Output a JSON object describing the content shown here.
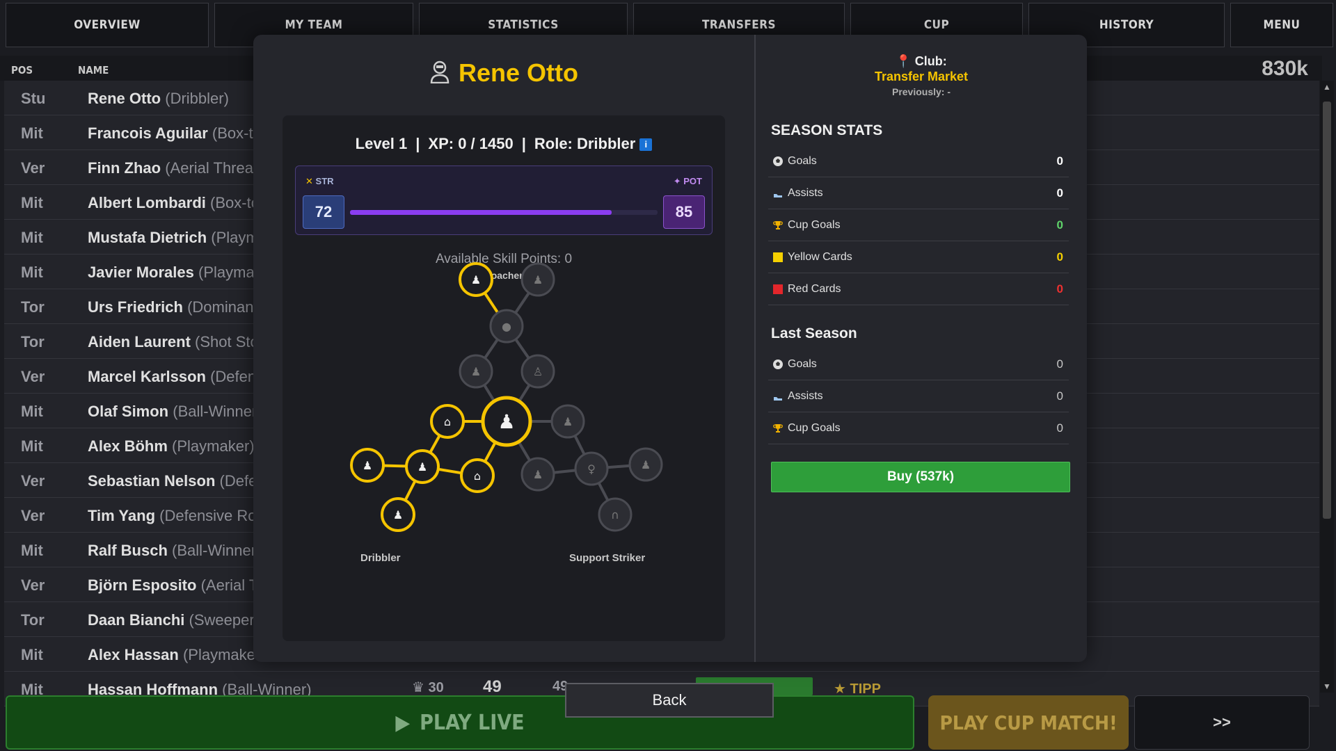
{
  "nav": {
    "tabs": [
      {
        "label": "OVERVIEW"
      },
      {
        "label": "MY TEAM"
      },
      {
        "label": "STATISTICS"
      },
      {
        "label": "TRANSFERS"
      },
      {
        "label": "CUP"
      },
      {
        "label": "HISTORY"
      },
      {
        "label": "MENU"
      }
    ]
  },
  "table": {
    "headers": {
      "pos": "POS",
      "name": "NAME"
    },
    "balance": "830k",
    "rows": [
      {
        "pos": "Stu",
        "name": "Rene Otto",
        "role": "(Dribbler)"
      },
      {
        "pos": "Mit",
        "name": "Francois Aguilar",
        "role": "(Box-to"
      },
      {
        "pos": "Ver",
        "name": "Finn Zhao",
        "role": "(Aerial Threat"
      },
      {
        "pos": "Mit",
        "name": "Albert Lombardi",
        "role": "(Box-to"
      },
      {
        "pos": "Mit",
        "name": "Mustafa Dietrich",
        "role": "(Playm"
      },
      {
        "pos": "Mit",
        "name": "Javier Morales",
        "role": "(Playmal"
      },
      {
        "pos": "Tor",
        "name": "Urs Friedrich",
        "role": "(Dominant"
      },
      {
        "pos": "Tor",
        "name": "Aiden Laurent",
        "role": "(Shot Sto"
      },
      {
        "pos": "Ver",
        "name": "Marcel Karlsson",
        "role": "(Defens"
      },
      {
        "pos": "Mit",
        "name": "Olaf Simon",
        "role": "(Ball-Winner"
      },
      {
        "pos": "Mit",
        "name": "Alex Böhm",
        "role": "(Playmaker)"
      },
      {
        "pos": "Ver",
        "name": "Sebastian Nelson",
        "role": "(Defe"
      },
      {
        "pos": "Ver",
        "name": "Tim Yang",
        "role": "(Defensive Ro"
      },
      {
        "pos": "Mit",
        "name": "Ralf Busch",
        "role": "(Ball-Winner"
      },
      {
        "pos": "Ver",
        "name": "Björn Esposito",
        "role": "(Aerial Tl"
      },
      {
        "pos": "Tor",
        "name": "Daan Bianchi",
        "role": "(Sweeper"
      },
      {
        "pos": "Mit",
        "name": "Alex Hassan",
        "role": "(Playmaker"
      },
      {
        "pos": "Mit",
        "name": "Hassan Hoffmann",
        "role": "(Ball-Winner)"
      }
    ],
    "last_row_extra": {
      "age": "30",
      "rating": "49",
      "rating2": "49",
      "tipp": "TIPP"
    }
  },
  "player": {
    "name": "Rene Otto",
    "level": "Level 1",
    "xp": "XP: 0 / 1450",
    "role": "Role: Dribbler",
    "info_icon": "i",
    "str_label": "STR",
    "pot_label": "POT",
    "str": "72",
    "pot": "85",
    "progress_pct": 85,
    "skill_points": "Available Skill Points: 0",
    "tree_top_label": "Poacher",
    "tree_left_label": "Dribbler",
    "tree_right_label": "Support Striker"
  },
  "club": {
    "label": "Club:",
    "value": "Transfer Market",
    "previously": "Previously: -"
  },
  "season_stats": {
    "title": "SEASON STATS",
    "rows": [
      {
        "label": "Goals",
        "value": "0",
        "icon": "football-icon",
        "color": "#ffffff"
      },
      {
        "label": "Assists",
        "value": "0",
        "icon": "boot-icon",
        "color": "#ffffff"
      },
      {
        "label": "Cup Goals",
        "value": "0",
        "icon": "trophy-icon",
        "color": "#5fd36a"
      },
      {
        "label": "Yellow Cards",
        "value": "0",
        "icon": "yellow-card-icon",
        "color": "#f5d000"
      },
      {
        "label": "Red Cards",
        "value": "0",
        "icon": "red-card-icon",
        "color": "#ee3030"
      }
    ]
  },
  "last_season": {
    "title": "Last Season",
    "rows": [
      {
        "label": "Goals",
        "value": "0",
        "icon": "football-icon"
      },
      {
        "label": "Assists",
        "value": "0",
        "icon": "boot-icon"
      },
      {
        "label": "Cup Goals",
        "value": "0",
        "icon": "trophy-icon"
      }
    ]
  },
  "buttons": {
    "buy": "Buy (537k)",
    "back": "Back",
    "play_live": "PLAY LIVE",
    "play_cup": "PLAY CUP MATCH!",
    "next": ">>"
  },
  "colors": {
    "accent": "#f5c400",
    "buy": "#2e9e3a",
    "str": "#2a3e78",
    "pot": "#4a2474",
    "bar": "#8a3df0"
  }
}
